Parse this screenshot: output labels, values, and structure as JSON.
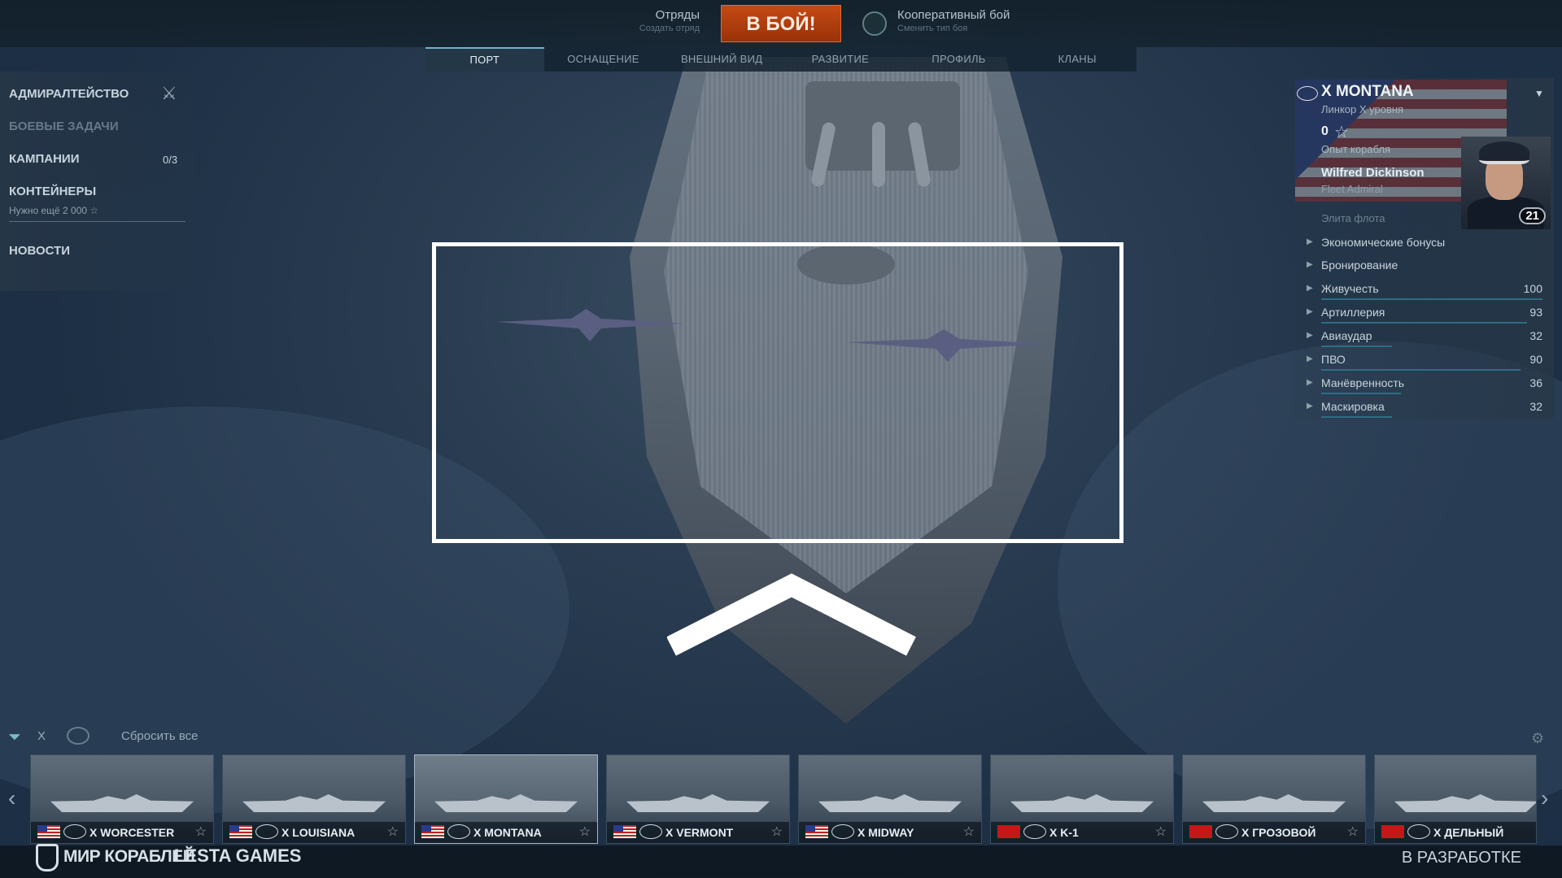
{
  "topbar": {
    "squads_label": "Отряды",
    "squads_sub": "Создать отряд",
    "battle_label": "В БОЙ!",
    "mode_label": "Кооперативный бой",
    "mode_sub": "Сменить тип боя"
  },
  "tabs": [
    {
      "label": "ПОРТ",
      "active": true
    },
    {
      "label": "ОСНАЩЕНИЕ"
    },
    {
      "label": "ВНЕШНИЙ ВИД"
    },
    {
      "label": "РАЗВИТИЕ"
    },
    {
      "label": "ПРОФИЛЬ"
    },
    {
      "label": "КЛАНЫ"
    }
  ],
  "leftmenu": {
    "admiralty": "АДМИРАЛТЕЙСТВО",
    "missions": "БОЕВЫЕ ЗАДАЧИ",
    "campaigns": "КАМПАНИИ",
    "campaigns_count": "0/3",
    "containers": "КОНТЕЙНЕРЫ",
    "containers_sub": "Нужно ещё  2 000 ☆",
    "news": "НОВОСТИ"
  },
  "ship": {
    "name": "X MONTANA",
    "subtitle": "Линкор X уровня",
    "xp_value": "0",
    "xp_label": "Опыт корабля",
    "captain_name": "Wilfred Dickinson",
    "captain_rank": "Fleet Admiral",
    "elite": "Элита флота",
    "captain_level": "21"
  },
  "stats": [
    {
      "label": "Экономические бонусы",
      "value": "",
      "bar": 0
    },
    {
      "label": "Бронирование",
      "value": "",
      "bar": 0
    },
    {
      "label": "Живучесть",
      "value": "100",
      "bar": 1.0
    },
    {
      "label": "Артиллерия",
      "value": "93",
      "bar": 0.93
    },
    {
      "label": "Авиаудар",
      "value": "32",
      "bar": 0.32
    },
    {
      "label": "ПВО",
      "value": "90",
      "bar": 0.9
    },
    {
      "label": "Манёвренность",
      "value": "36",
      "bar": 0.36
    },
    {
      "label": "Маскировка",
      "value": "32",
      "bar": 0.32
    }
  ],
  "filter": {
    "tier": "X",
    "reset": "Сбросить все"
  },
  "carousel": [
    {
      "name": "X WORCESTER",
      "nation": "us"
    },
    {
      "name": "X LOUISIANA",
      "nation": "us"
    },
    {
      "name": "X MONTANA",
      "nation": "us",
      "selected": true
    },
    {
      "name": "X VERMONT",
      "nation": "us"
    },
    {
      "name": "X MIDWAY",
      "nation": "us"
    },
    {
      "name": "X K-1",
      "nation": "su"
    },
    {
      "name": "X ГРОЗОВОЙ",
      "nation": "su"
    },
    {
      "name": "X ДЕЛЬНЫЙ",
      "nation": "su"
    }
  ],
  "footer": {
    "logo_left": "МИР КОРАБЛЕЙ",
    "logo_right": "LESTA GAMES",
    "status": "В РАЗРАБОТКЕ"
  },
  "colors": {
    "accent": "#c44a14",
    "tab_active": "#6fb3c9",
    "stat_bar": "#2f6d82"
  }
}
